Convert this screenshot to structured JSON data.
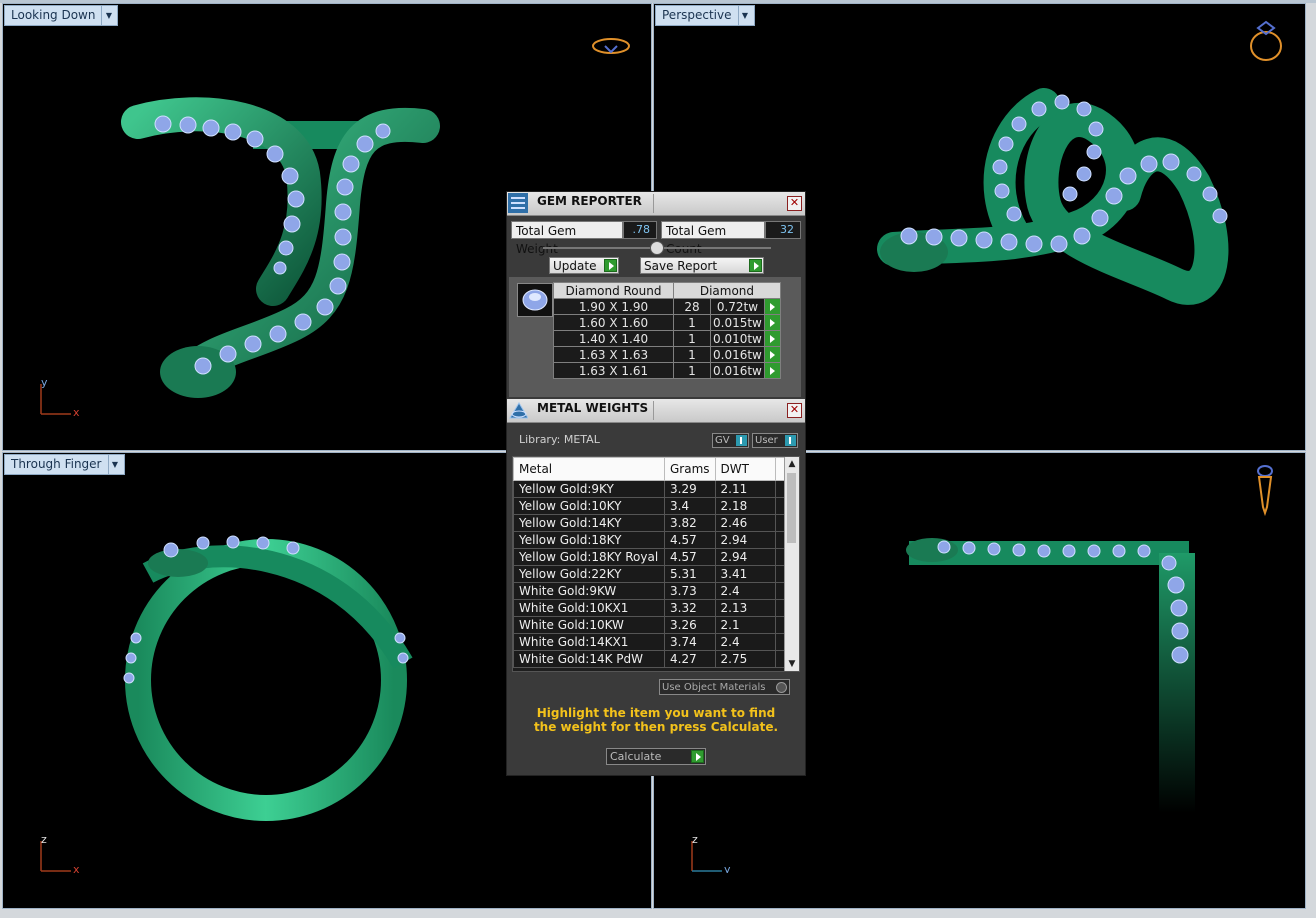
{
  "viewports": {
    "top_left": {
      "label": "Looking Down",
      "axes": [
        "y",
        "x"
      ]
    },
    "top_right": {
      "label": "Perspective"
    },
    "bottom_left": {
      "label": "Through Finger",
      "axes": [
        "z",
        "x"
      ]
    },
    "bottom_right": {
      "label": "",
      "axes": [
        "z",
        "y"
      ]
    }
  },
  "gem_reporter": {
    "title": "GEM REPORTER",
    "total_weight_label": "Total Gem Weight",
    "total_weight_value": ".78",
    "total_count_label": "Total Gem Count",
    "total_count_value": "32",
    "update_label": "Update",
    "save_report_label": "Save Report",
    "headers": [
      "Diamond Round",
      "Diamond"
    ],
    "rows": [
      {
        "size": "1.90 X 1.90",
        "count": "28",
        "weight": "0.72tw"
      },
      {
        "size": "1.60 X 1.60",
        "count": "1",
        "weight": "0.015tw"
      },
      {
        "size": "1.40 X 1.40",
        "count": "1",
        "weight": "0.010tw"
      },
      {
        "size": "1.63 X 1.63",
        "count": "1",
        "weight": "0.016tw"
      },
      {
        "size": "1.63 X 1.61",
        "count": "1",
        "weight": "0.016tw"
      }
    ]
  },
  "metal_weights": {
    "title": "METAL WEIGHTS",
    "library_label": "Library: METAL",
    "gv_label": "GV",
    "user_label": "User",
    "headers": [
      "Metal",
      "Grams",
      "DWT"
    ],
    "rows": [
      {
        "metal": "Yellow Gold:9KY",
        "grams": "3.29",
        "dwt": "2.11"
      },
      {
        "metal": "Yellow Gold:10KY",
        "grams": "3.4",
        "dwt": "2.18"
      },
      {
        "metal": "Yellow Gold:14KY",
        "grams": "3.82",
        "dwt": "2.46"
      },
      {
        "metal": "Yellow Gold:18KY",
        "grams": "4.57",
        "dwt": "2.94"
      },
      {
        "metal": "Yellow Gold:18KY Royal",
        "grams": "4.57",
        "dwt": "2.94"
      },
      {
        "metal": "Yellow Gold:22KY",
        "grams": "5.31",
        "dwt": "3.41"
      },
      {
        "metal": "White Gold:9KW",
        "grams": "3.73",
        "dwt": "2.4"
      },
      {
        "metal": "White Gold:10KX1",
        "grams": "3.32",
        "dwt": "2.13"
      },
      {
        "metal": "White Gold:10KW",
        "grams": "3.26",
        "dwt": "2.1"
      },
      {
        "metal": "White Gold:14KX1",
        "grams": "3.74",
        "dwt": "2.4"
      },
      {
        "metal": "White Gold:14K PdW",
        "grams": "4.27",
        "dwt": "2.75"
      }
    ],
    "use_object_materials_label": "Use Object Materials",
    "hint": "Highlight the item you want to find the weight for then press Calculate.",
    "calculate_label": "Calculate"
  },
  "colors": {
    "metal_green": "#1f8a5f",
    "gem_blue": "#8fa6e8",
    "accent_yellow": "#f3c21b"
  }
}
